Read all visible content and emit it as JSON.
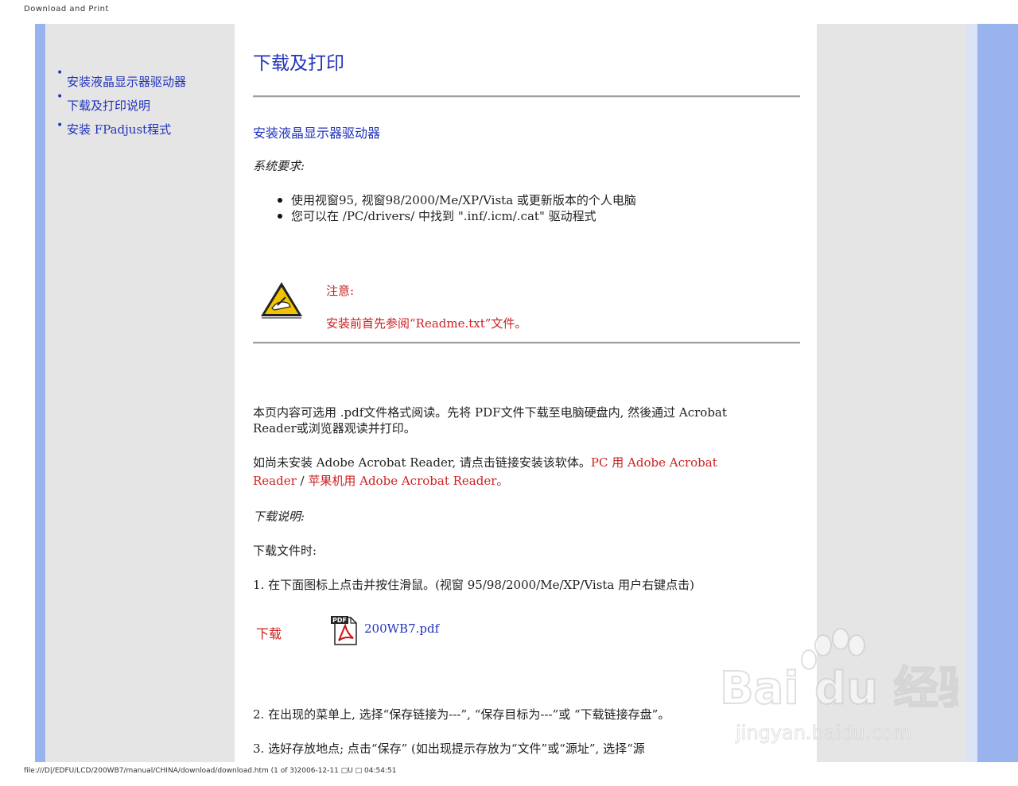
{
  "print_header": "Download and Print",
  "print_footer": "file:///D|/EDFU/LCD/200WB7/manual/CHINA/download/download.htm (1 of 3)2006-12-11 □U □ 04:54:51",
  "sidebar": {
    "items": [
      {
        "label": "安装液晶显示器驱动器"
      },
      {
        "label": "下载及打印说明"
      },
      {
        "label": "安装 FPadjust程式"
      }
    ]
  },
  "main": {
    "title": "下载及打印",
    "section_link": "安装液晶显示器驱动器",
    "requirements_heading": "系统要求:",
    "requirements": [
      "使用视窗95, 视窗98/2000/Me/XP/Vista 或更新版本的个人电脑",
      "您可以在 /PC/drivers/ 中找到 \".inf/.icm/.cat\" 驱动程式"
    ],
    "note": {
      "heading": "注意:",
      "body": "安装前首先参阅“Readme.txt”文件。"
    },
    "pdf_intro_line1": "本页内容可选用 .pdf文件格式阅读。先将 PDF文件下载至电脑硬盘内, 然後通过 Acrobat",
    "pdf_intro_line2": "Reader或浏览器观读并打印。",
    "adobe_line1_plain": "如尚未安装 Adobe   Acrobat Reader, 请点击链接安装该软体。",
    "adobe_line1_link": "PC 用 Adobe   Acrobat",
    "adobe_line2_link_a": "Reader",
    "adobe_line2_sep": " / ",
    "adobe_line2_link_b": "苹果机用 Adobe   Acrobat Reader。",
    "download_heading": "下载说明:",
    "download_file_when": "下载文件时:",
    "step1": "1.  在下面图标上点击并按住滑鼠。(视窗 95/98/2000/Me/XP/Vista 用户右键点击)",
    "download_label": "下载",
    "pdf_filename": "200WB7.pdf",
    "step2": "2.  在出现的菜单上, 选择“保存链接为---”, “保存目标为---”或 “下载链接存盘”。",
    "step3": "3.  选好存放地点; 点击“保存” (如出现提示存放为“文件”或“源址”,  选择“源"
  },
  "watermark": {
    "brand": "Bai du 经验",
    "url": "jingyan.baidu.com"
  },
  "colors": {
    "link_blue": "#2233bb",
    "note_red": "#cc2222",
    "band_blue": "#99b3ee",
    "panel_gray": "#e5e5e5"
  },
  "icons": {
    "warning": "warning-hand-icon",
    "pdf": "pdf-file-icon"
  }
}
